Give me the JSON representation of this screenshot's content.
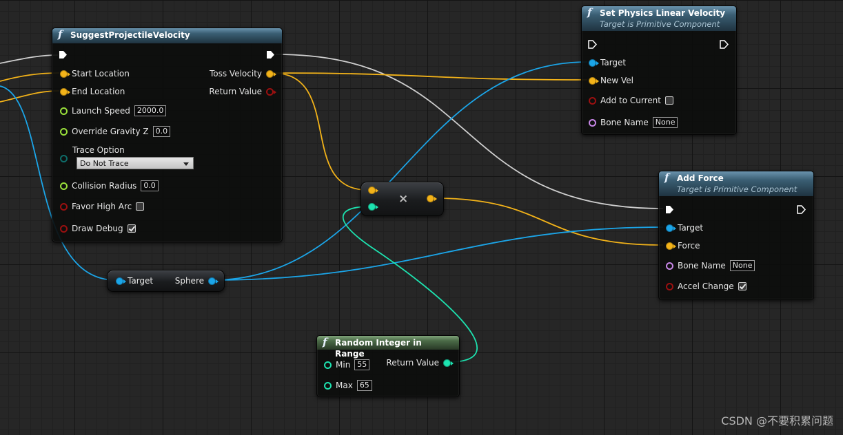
{
  "colors": {
    "vector": "#f3b319",
    "object": "#1ba5e8",
    "float": "#9ae03b",
    "bool": "#9b1010",
    "name": "#c887e8",
    "int": "#1de3b0",
    "byte": "#0e6b68",
    "exec": "#ffffff",
    "wire_exec": "#d0d0d0"
  },
  "nodes": {
    "suggest": {
      "title": "SuggestProjectileVelocity",
      "pins": {
        "start_location": "Start Location",
        "end_location": "End Location",
        "launch_speed": "Launch Speed",
        "launch_speed_value": "2000.0",
        "override_gravity": "Override Gravity Z",
        "override_gravity_value": "0.0",
        "trace_option": "Trace Option",
        "trace_option_value": "Do Not Trace",
        "collision_radius": "Collision Radius",
        "collision_radius_value": "0.0",
        "favor_high_arc": "Favor High Arc",
        "favor_high_arc_checked": false,
        "draw_debug": "Draw Debug",
        "draw_debug_checked": true,
        "toss_velocity": "Toss Velocity",
        "return_value": "Return Value"
      }
    },
    "set_velocity": {
      "title": "Set Physics Linear Velocity",
      "subtitle": "Target is Primitive Component",
      "pins": {
        "target": "Target",
        "new_vel": "New Vel",
        "add_to_current": "Add to Current",
        "add_to_current_checked": false,
        "bone_name": "Bone Name",
        "bone_name_value": "None"
      }
    },
    "add_force": {
      "title": "Add Force",
      "subtitle": "Target is Primitive Component",
      "pins": {
        "target": "Target",
        "force": "Force",
        "bone_name": "Bone Name",
        "bone_name_value": "None",
        "accel_change": "Accel Change",
        "accel_change_checked": true
      }
    },
    "multiply": {
      "symbol": "×"
    },
    "get_sphere": {
      "input": "Target",
      "output": "Sphere"
    },
    "random_int": {
      "title": "Random Integer in Range",
      "pins": {
        "min": "Min",
        "min_value": "55",
        "max": "Max",
        "max_value": "65",
        "return_value": "Return Value"
      }
    }
  },
  "watermark": "CSDN @不要积累问题"
}
